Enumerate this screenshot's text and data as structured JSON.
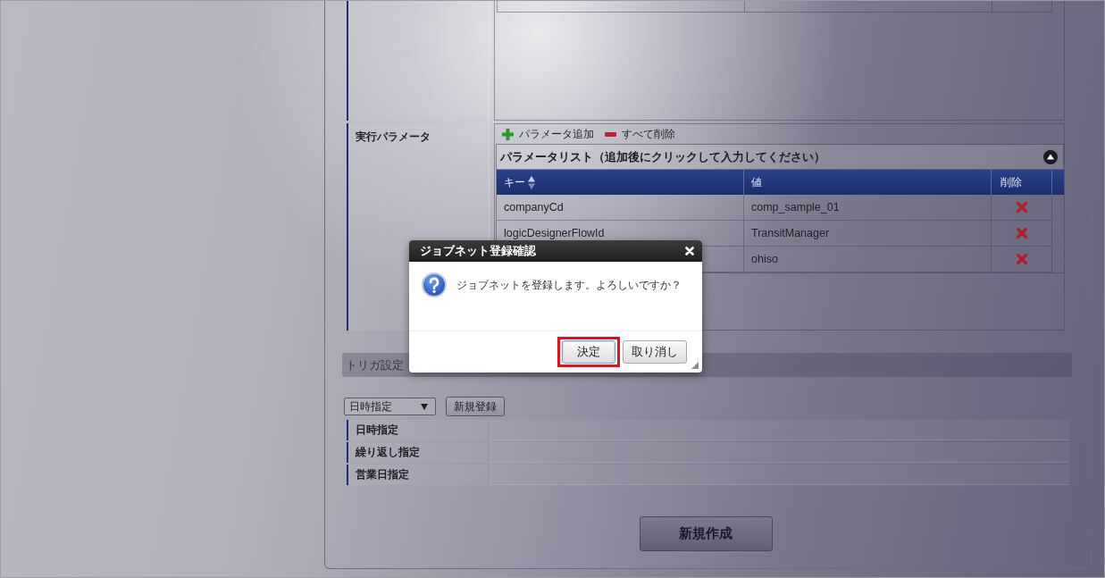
{
  "parameters": {
    "label": "実行パラメータ",
    "actions": [
      {
        "kind": "add",
        "label": "パラメータ追加"
      },
      {
        "kind": "remove",
        "label": "すべて削除"
      }
    ],
    "list": {
      "title": "パラメータリスト（追加後にクリックして入力してください）",
      "expanded": true,
      "columns": [
        {
          "label": "キー",
          "sortable": true
        },
        {
          "label": "値",
          "sortable": false
        },
        {
          "label": "削除",
          "sortable": false
        }
      ],
      "rows": [
        {
          "key": "companyCd",
          "value": "comp_sample_01"
        },
        {
          "key": "logicDesignerFlowId",
          "value": "TransitManager"
        },
        {
          "value": "ohiso"
        }
      ]
    }
  },
  "trigger": {
    "title": "トリガ設定",
    "type_select": {
      "value": "日時指定"
    },
    "register_button": "新規登録",
    "rows": [
      {
        "label": "日時指定"
      },
      {
        "label": "繰り返し指定"
      },
      {
        "label": "営業日指定"
      }
    ]
  },
  "create_button": "新規作成",
  "dialog": {
    "title": "ジョブネット登録確認",
    "message": "ジョブネットを登録します。よろしいですか？",
    "buttons": [
      {
        "label": "決定",
        "highlighted": true
      },
      {
        "label": "取り消し",
        "highlighted": false
      }
    ]
  }
}
